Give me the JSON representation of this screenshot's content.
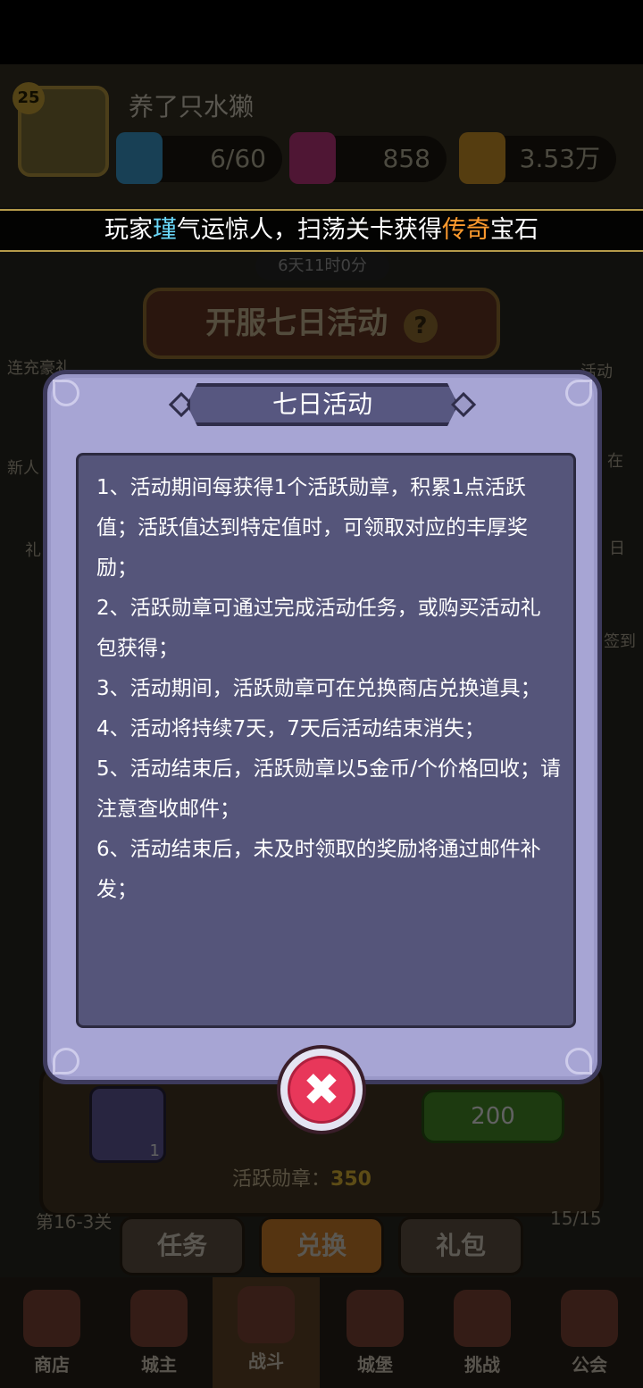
{
  "background": {
    "player": {
      "level": "25",
      "name": "养了只水獭"
    },
    "resources": [
      {
        "name": "energy",
        "value": "6/60",
        "icon": "lightning-icon",
        "color": "#3fa8e0"
      },
      {
        "name": "gems",
        "value": "858",
        "icon": "gem-icon",
        "color": "#d03a8a"
      },
      {
        "name": "gold",
        "value": "3.53万",
        "icon": "coin-icon",
        "color": "#e0a02a"
      }
    ],
    "ticker": {
      "prefix": "玩家",
      "player": "瑾",
      "middle": "气运惊人，扫荡关卡获得",
      "item": "传奇",
      "suffix": "宝石"
    },
    "event": {
      "timer": "6天11时0分",
      "title": "开服七日活动",
      "help": "?"
    },
    "side_left": [
      "连充豪礼",
      "新人",
      "礼"
    ],
    "side_right": [
      "活动",
      "在",
      "日",
      "签到"
    ],
    "shop_item": {
      "count": "1",
      "price": "200"
    },
    "medal": {
      "label": "活跃勋章：",
      "value": "350"
    },
    "sub_tabs": [
      "任务",
      "兑换",
      "礼包"
    ],
    "progress_left": "第16-3关",
    "progress_right": "15/15",
    "nav": [
      "商店",
      "城主",
      "战斗",
      "城堡",
      "挑战",
      "公会"
    ]
  },
  "modal": {
    "title": "七日活动",
    "rules": [
      "1、活动期间每获得1个活跃勋章，积累1点活跃值；活跃值达到特定值时，可领取对应的丰厚奖励；",
      "2、活跃勋章可通过完成活动任务，或购买活动礼包获得；",
      "3、活动期间，活跃勋章可在兑换商店兑换道具；",
      "4、活动将持续7天，7天后活动结束消失；",
      "5、活动结束后，活跃勋章以5金币/个价格回收；请注意查收邮件；",
      "6、活动结束后，未及时领取的奖励将通过邮件补发；"
    ],
    "close_icon": "close-icon",
    "colors": {
      "panel": "#a7a5d4",
      "box": "#55557a",
      "close": "#e8375a"
    }
  }
}
